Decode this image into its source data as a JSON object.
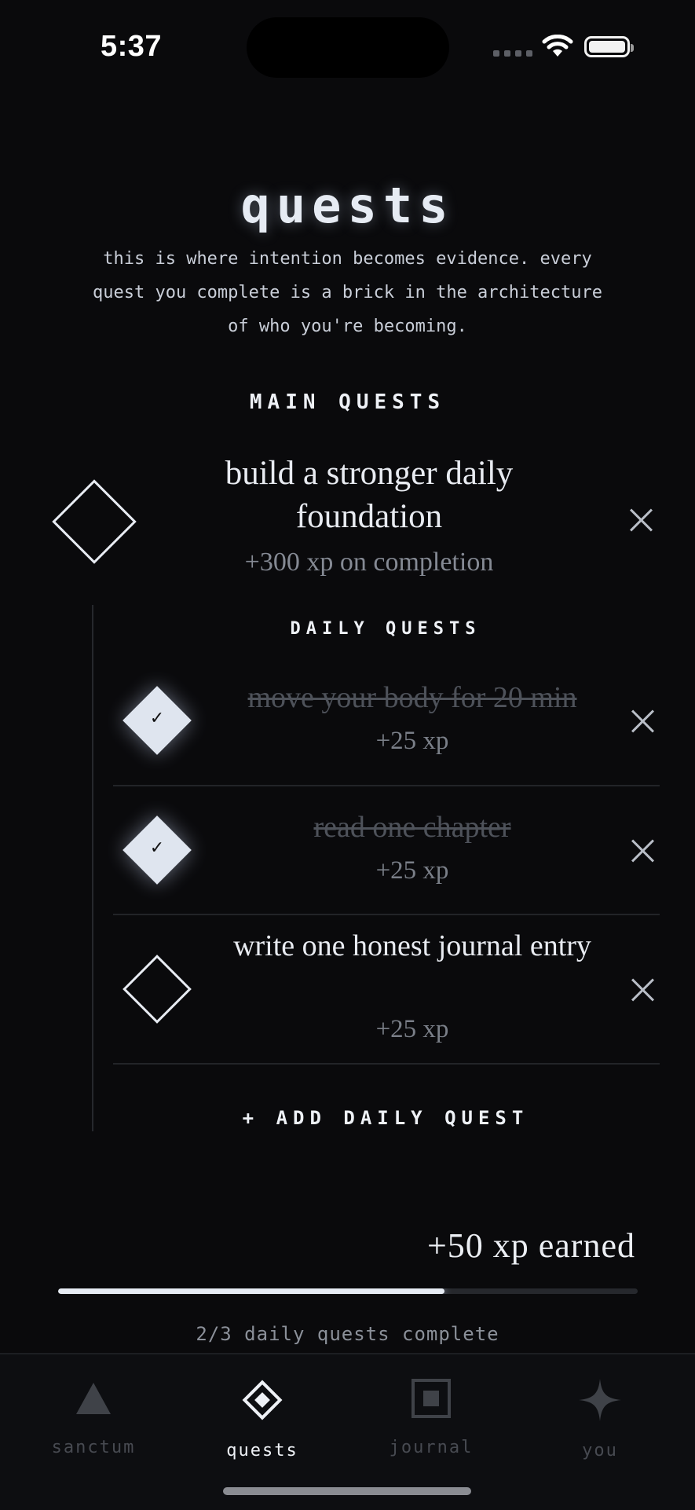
{
  "status_bar": {
    "time": "5:37"
  },
  "header": {
    "title": "quests",
    "subtitle": "this is where intention becomes evidence. every quest you complete is a brick in the architecture of who you're becoming."
  },
  "main_quests": {
    "label": "MAIN QUESTS",
    "items": [
      {
        "title": "build a stronger daily foundation",
        "xp": "+300 xp on completion",
        "completed": false
      }
    ]
  },
  "daily_quests": {
    "label": "DAILY QUESTS",
    "items": [
      {
        "title": "move your body for 20 min",
        "xp": "+25 xp",
        "completed": true
      },
      {
        "title": "read one chapter",
        "xp": "+25 xp",
        "completed": true
      },
      {
        "title": "write one honest journal entry",
        "xp": "+25 xp",
        "completed": false
      }
    ],
    "add_label": "+ ADD DAILY QUEST"
  },
  "progress": {
    "xp_earned": "+50 xp earned",
    "completed": 2,
    "total": 3,
    "fraction": 0.667,
    "label": "2/3 daily quests complete"
  },
  "tab_bar": {
    "tabs": [
      {
        "label": "sanctum",
        "icon": "triangle-icon",
        "active": false
      },
      {
        "label": "quests",
        "icon": "diamond-icon",
        "active": true
      },
      {
        "label": "journal",
        "icon": "square-icon",
        "active": false
      },
      {
        "label": "you",
        "icon": "sparkle-icon",
        "active": false
      }
    ]
  },
  "colors": {
    "background": "#0a0a0c",
    "accent": "#e6ebf3",
    "muted": "#7a7f88"
  }
}
